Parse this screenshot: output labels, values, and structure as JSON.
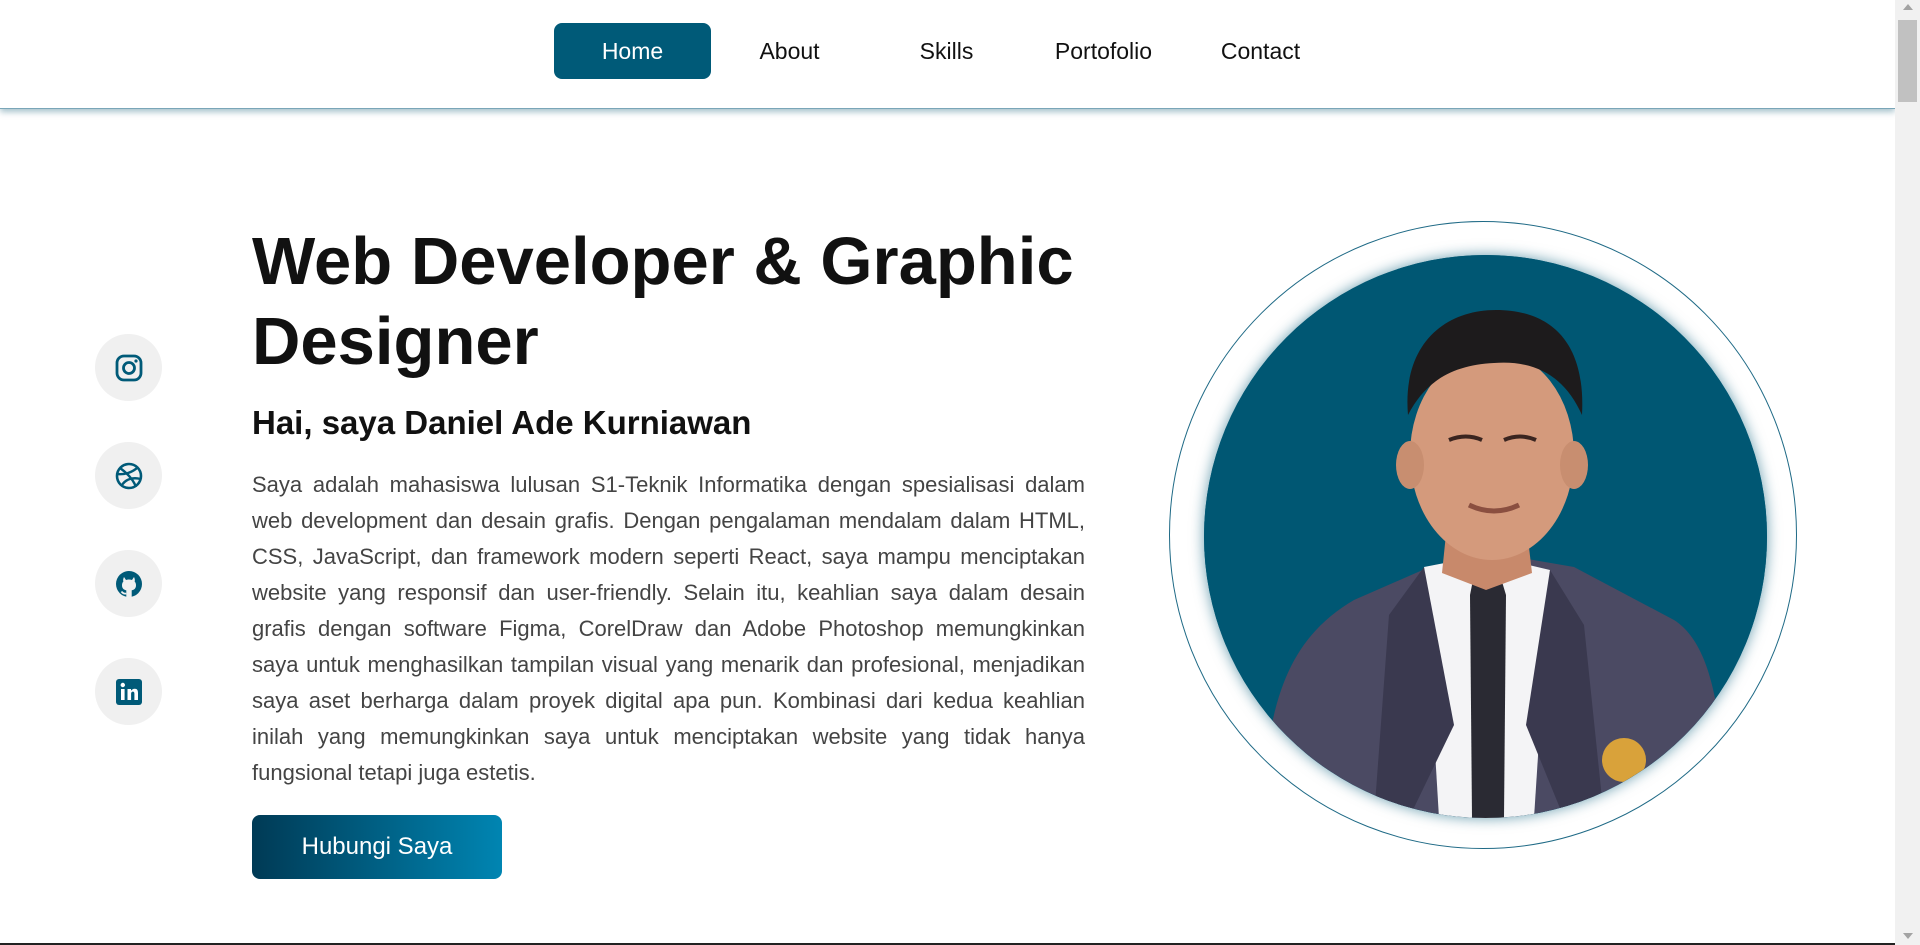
{
  "nav": {
    "items": [
      {
        "label": "Home",
        "active": true
      },
      {
        "label": "About",
        "active": false
      },
      {
        "label": "Skills",
        "active": false
      },
      {
        "label": "Portofolio",
        "active": false
      },
      {
        "label": "Contact",
        "active": false
      }
    ]
  },
  "social": [
    "instagram-icon",
    "dribbble-icon",
    "github-icon",
    "linkedin-icon"
  ],
  "hero": {
    "title": "Web Developer & Graphic Designer",
    "greeting": "Hai, saya Daniel Ade Kurniawan",
    "description": "Saya adalah mahasiswa lulusan S1-Teknik Informatika dengan spesialisasi dalam web development dan desain grafis. Dengan pengalaman mendalam dalam HTML, CSS, JavaScript, dan framework modern seperti React, saya mampu menciptakan website yang responsif dan user-friendly. Selain itu, keahlian saya dalam desain grafis dengan software Figma, CorelDraw dan Adobe Photoshop memungkinkan saya untuk menghasilkan tampilan visual yang menarik dan profesional, menjadikan saya aset berharga dalam proyek digital apa pun. Kombinasi dari kedua keahlian inilah yang memungkinkan saya untuk menciptakan website yang tidak hanya fungsional tetapi juga estetis.",
    "cta_label": "Hubungi Saya"
  },
  "colors": {
    "primary": "#005a78",
    "photo_bg": "#005773",
    "gradient_start": "#003a55",
    "gradient_end": "#0085b2"
  }
}
